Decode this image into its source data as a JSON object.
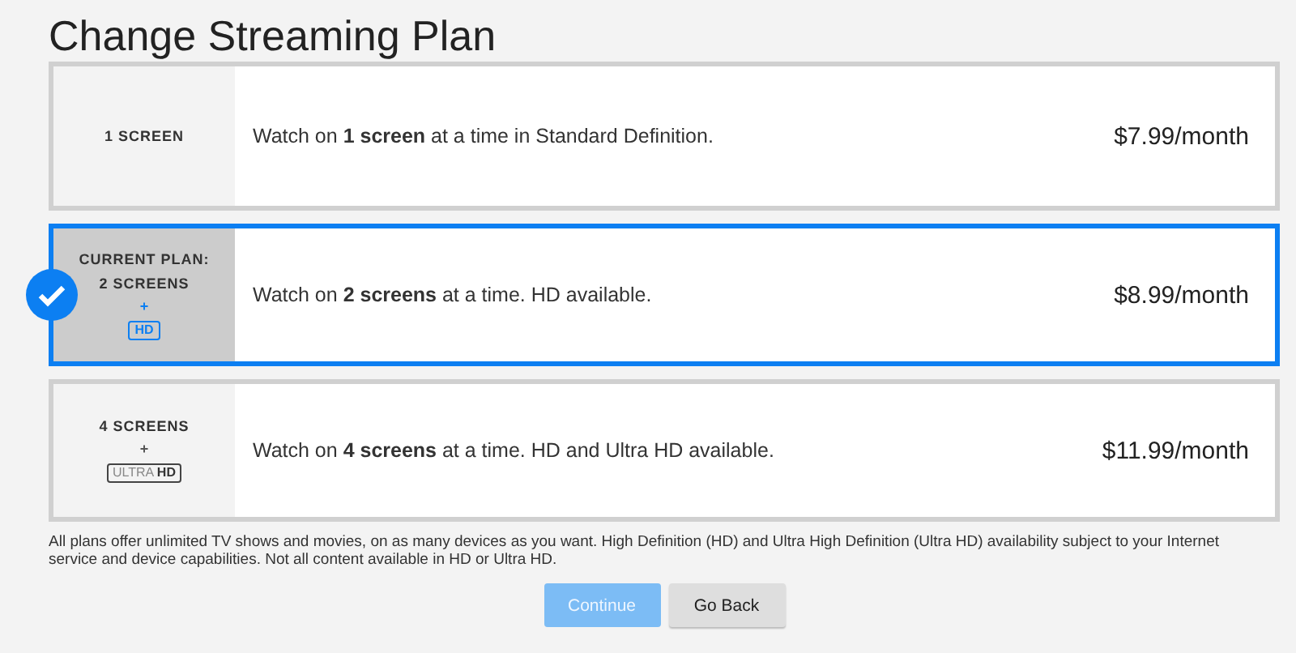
{
  "title": "Change Streaming Plan",
  "plans": [
    {
      "selected": false,
      "screens": "1 SCREEN",
      "description": "Watch on **1 screen** at a time in Standard Definition.",
      "price": "$7.99/month"
    },
    {
      "selected": true,
      "current_label": "CURRENT PLAN:",
      "screens": "2 SCREENS",
      "plus": "+",
      "badge": "HD",
      "description": "Watch on **2 screens** at a time. HD available.",
      "price": "$8.99/month"
    },
    {
      "selected": false,
      "screens": "4 SCREENS",
      "plus": "+",
      "badge": "ULTRA **HD**",
      "description": "Watch on **4 screens** at a time. HD and Ultra HD available.",
      "price": "$11.99/month"
    }
  ],
  "footnote": "All plans offer unlimited TV shows and movies, on as many devices as you want. High Definition (HD) and Ultra High Definition (Ultra HD) availability subject to your Internet service and device capabilities. Not all content available in HD or Ultra HD.",
  "buttons": [
    {
      "label": "Continue",
      "kind": "primary",
      "disabled": true
    },
    {
      "label": "Go Back",
      "kind": "secondary",
      "disabled": false
    }
  ]
}
